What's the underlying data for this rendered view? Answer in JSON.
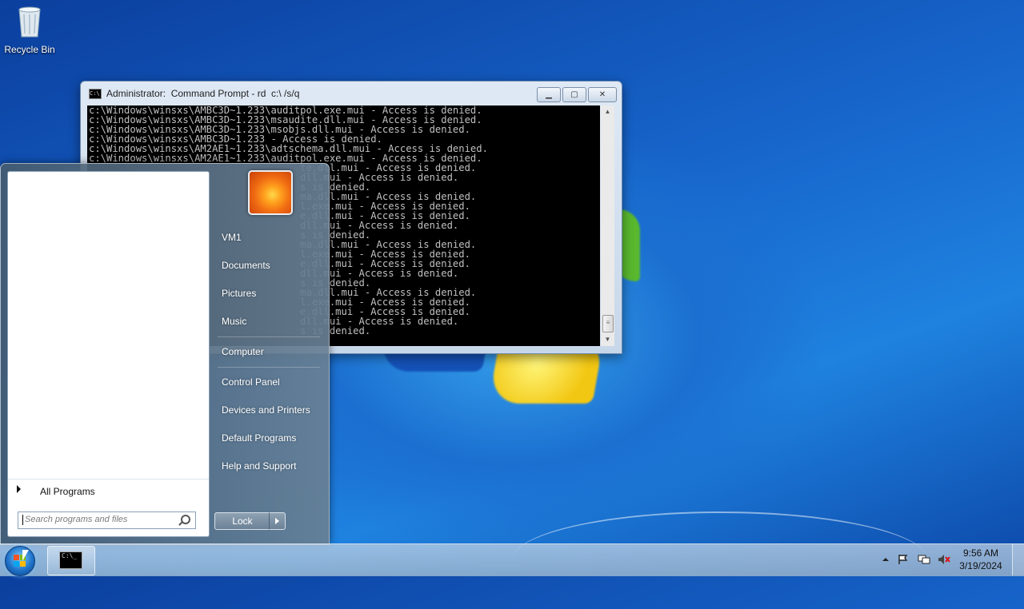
{
  "desktop": {
    "recycle_bin_label": "Recycle Bin"
  },
  "cmd_window": {
    "title": "Administrator:  Command Prompt - rd  c:\\ /s/q",
    "buttons": {
      "minimize": "minimize",
      "maximize": "maximize",
      "close": "close"
    },
    "lines": [
      "c:\\Windows\\winsxs\\AMBC3D~1.233\\auditpol.exe.mui - Access is denied.",
      "c:\\Windows\\winsxs\\AMBC3D~1.233\\msaudite.dll.mui - Access is denied.",
      "c:\\Windows\\winsxs\\AMBC3D~1.233\\msobjs.dll.mui - Access is denied.",
      "c:\\Windows\\winsxs\\AMBC3D~1.233 - Access is denied.",
      "c:\\Windows\\winsxs\\AM2AE1~1.233\\adtschema.dll.mui - Access is denied.",
      "c:\\Windows\\winsxs\\AM2AE1~1.233\\auditpol.exe.mui - Access is denied.",
      "                                    te.dll.mui - Access is denied.",
      "                                    dll.mui - Access is denied.",
      "                                    s is denied.",
      "                                    ma.dll.mui - Access is denied.",
      "                                    l.exe.mui - Access is denied.",
      "                                    e.dll.mui - Access is denied.",
      "                                    dll.mui - Access is denied.",
      "                                    s is denied.",
      "                                    ma.dll.mui - Access is denied.",
      "                                    l.exe.mui - Access is denied.",
      "                                    e.dll.mui - Access is denied.",
      "                                    dll.mui - Access is denied.",
      "                                    s is denied.",
      "                                    ma.dll.mui - Access is denied.",
      "                                    l.exe.mui - Access is denied.",
      "                                    e.dll.mui - Access is denied.",
      "                                    dll.mui - Access is denied.",
      "                                    s is denied."
    ]
  },
  "start_menu": {
    "right_items": [
      "VM1",
      "Documents",
      "Pictures",
      "Music",
      "Computer",
      "Control Panel",
      "Devices and Printers",
      "Default Programs",
      "Help and Support"
    ],
    "all_programs": "All Programs",
    "search_placeholder": "Search programs and files",
    "lock_label": "Lock"
  },
  "taskbar": {
    "clock_time": "9:56 AM",
    "clock_date": "3/19/2024"
  },
  "colors": {
    "accent": "#1f73c9",
    "console_bg": "#000000",
    "console_fg": "#c0c0c0"
  }
}
